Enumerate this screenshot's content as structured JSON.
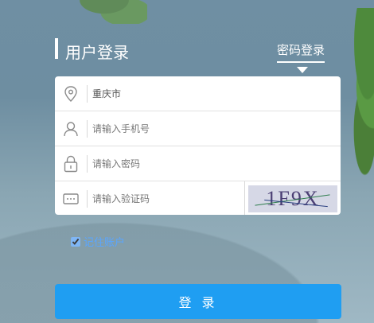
{
  "header": {
    "title": "用户登录",
    "tab_label": "密码登录"
  },
  "form": {
    "city_value": "重庆市",
    "phone_placeholder": "请输入手机号",
    "password_placeholder": "请输入密码",
    "captcha_placeholder": "请输入验证码",
    "captcha_text": "1F9X"
  },
  "remember": {
    "label": "记住账户",
    "checked": true
  },
  "login": {
    "button_label": "登 录"
  },
  "icons": {
    "location": "location-pin-icon",
    "user": "user-icon",
    "lock": "lock-icon",
    "captcha": "captcha-icon"
  },
  "colors": {
    "primary": "#1f9ef2",
    "link": "#5aa6ff"
  }
}
